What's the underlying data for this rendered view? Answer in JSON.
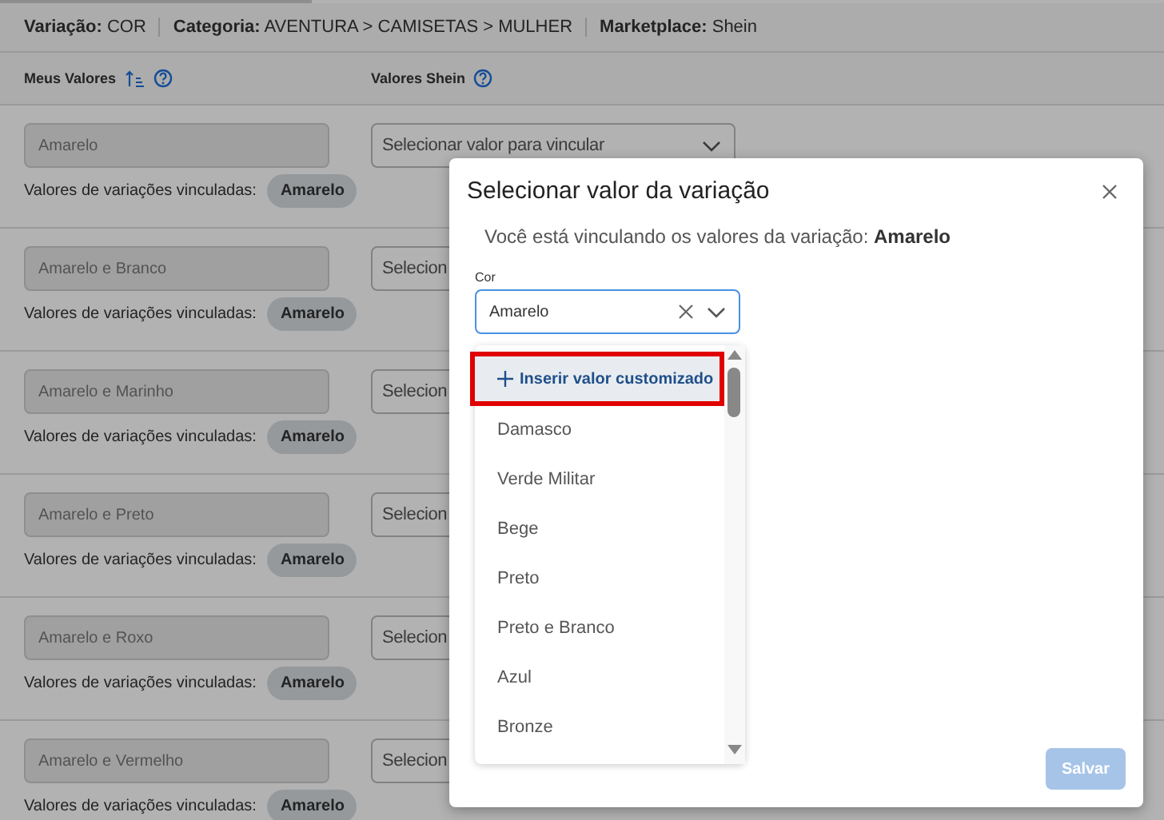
{
  "header": [
    {
      "label": "Variação:",
      "value": "COR"
    },
    {
      "label": "Categoria:",
      "value": "AVENTURA > CAMISETAS > MULHER"
    },
    {
      "label": "Marketplace:",
      "value": "Shein"
    }
  ],
  "columns": [
    {
      "label": "Meus Valores",
      "sortable": true
    },
    {
      "label": "Valores Shein",
      "sortable": false
    }
  ],
  "rows": [
    {
      "value": "Amarelo",
      "select_text": "Selecionar valor para vincular",
      "caret": true,
      "linked_label": "Valores de variações vinculadas:",
      "linked": [
        "Amarelo"
      ]
    },
    {
      "value": "Amarelo e Branco",
      "select_text": "Selecion",
      "linked_label": "Valores de variações vinculadas:",
      "linked": [
        "Amarelo"
      ]
    },
    {
      "value": "Amarelo e Marinho",
      "select_text": "Selecion",
      "linked_label": "Valores de variações vinculadas:",
      "linked": [
        "Amarelo"
      ]
    },
    {
      "value": "Amarelo e Preto",
      "select_text": "Selecion",
      "linked_label": "Valores de variações vinculadas:",
      "linked": [
        "Amarelo"
      ]
    },
    {
      "value": "Amarelo e Roxo",
      "select_text": "Selecion",
      "linked_label": "Valores de variações vinculadas:",
      "linked": [
        "Amarelo"
      ]
    },
    {
      "value": "Amarelo e Vermelho",
      "select_text": "Selecion",
      "linked_label": "Valores de variações vinculadas:",
      "linked": [
        "Amarelo"
      ]
    }
  ],
  "modal": {
    "title": "Selecionar valor da variação",
    "subtitle": "Você está vinculando os valores da variação: **Amarelo**",
    "field_label": "Cor",
    "field_value": "Amarelo",
    "options": [
      {
        "kind": "custom",
        "label": "Inserir valor customizado",
        "highlighted": true
      },
      {
        "kind": "option",
        "label": "Damasco",
        "highlighted": false
      },
      {
        "kind": "option",
        "label": "Verde Militar",
        "highlighted": false
      },
      {
        "kind": "option",
        "label": "Bege",
        "highlighted": false
      },
      {
        "kind": "option",
        "label": "Preto",
        "highlighted": false
      },
      {
        "kind": "option",
        "label": "Preto e Branco",
        "highlighted": false
      },
      {
        "kind": "option",
        "label": "Azul",
        "highlighted": false
      },
      {
        "kind": "option",
        "label": "Bronze",
        "highlighted": false
      }
    ],
    "save_button": {
      "label": "Salvar",
      "disabled": true
    }
  }
}
